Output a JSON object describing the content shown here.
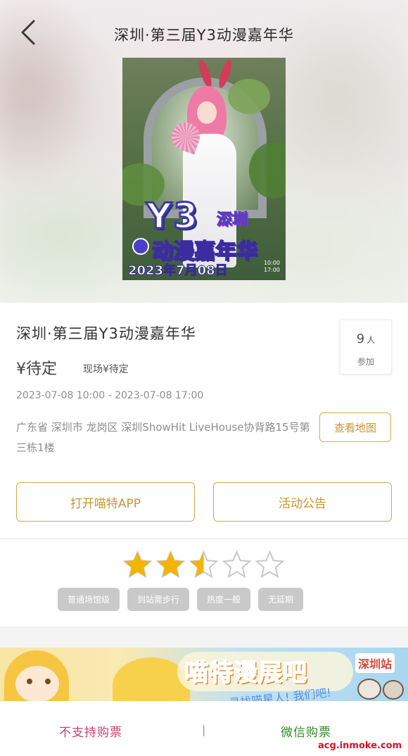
{
  "header": {
    "title": "深圳·第三届Y3动漫嘉年华"
  },
  "poster": {
    "logo": "Y3",
    "city": "深圳",
    "name": "动漫嘉年华",
    "date": "2023年7月08日",
    "time_start": "10:00",
    "time_end": "17:00"
  },
  "event": {
    "title": "深圳·第三届Y3动漫嘉年华",
    "price": "¥待定",
    "price_note": "现场¥待定",
    "attendees_count": "9",
    "attendees_unit": "人",
    "attendees_label": "参加",
    "datetime": "2023-07-08 10:00 - 2023-07-08 17:00",
    "address": "广东省 深圳市 龙岗区 深圳ShowHit LiveHouse协背路15号第三栋1楼",
    "map_button": "查看地图",
    "open_app_button": "打开喵特APP",
    "notice_button": "活动公告"
  },
  "rating": {
    "stars": 2.5,
    "max": 5,
    "star_color": "#f4b400",
    "empty_color": "#c8c8c8"
  },
  "tags": [
    "普通场馆级",
    "到站需步行",
    "热度一般",
    "无延期"
  ],
  "banner": {
    "title": "喵特漫展吧",
    "badge": "深圳站",
    "subtitle": "寻找喵星人! 我们吧!"
  },
  "bottom_bar": {
    "no_purchase": "不支持购票",
    "separator": "|",
    "wechat_purchase": "微信购票"
  },
  "watermark": "acg.inmoke.com",
  "colors": {
    "accent": "#d6a94a",
    "accent_text": "#c99531",
    "no_buy": "#c8416f",
    "wechat": "#2f8a22"
  }
}
